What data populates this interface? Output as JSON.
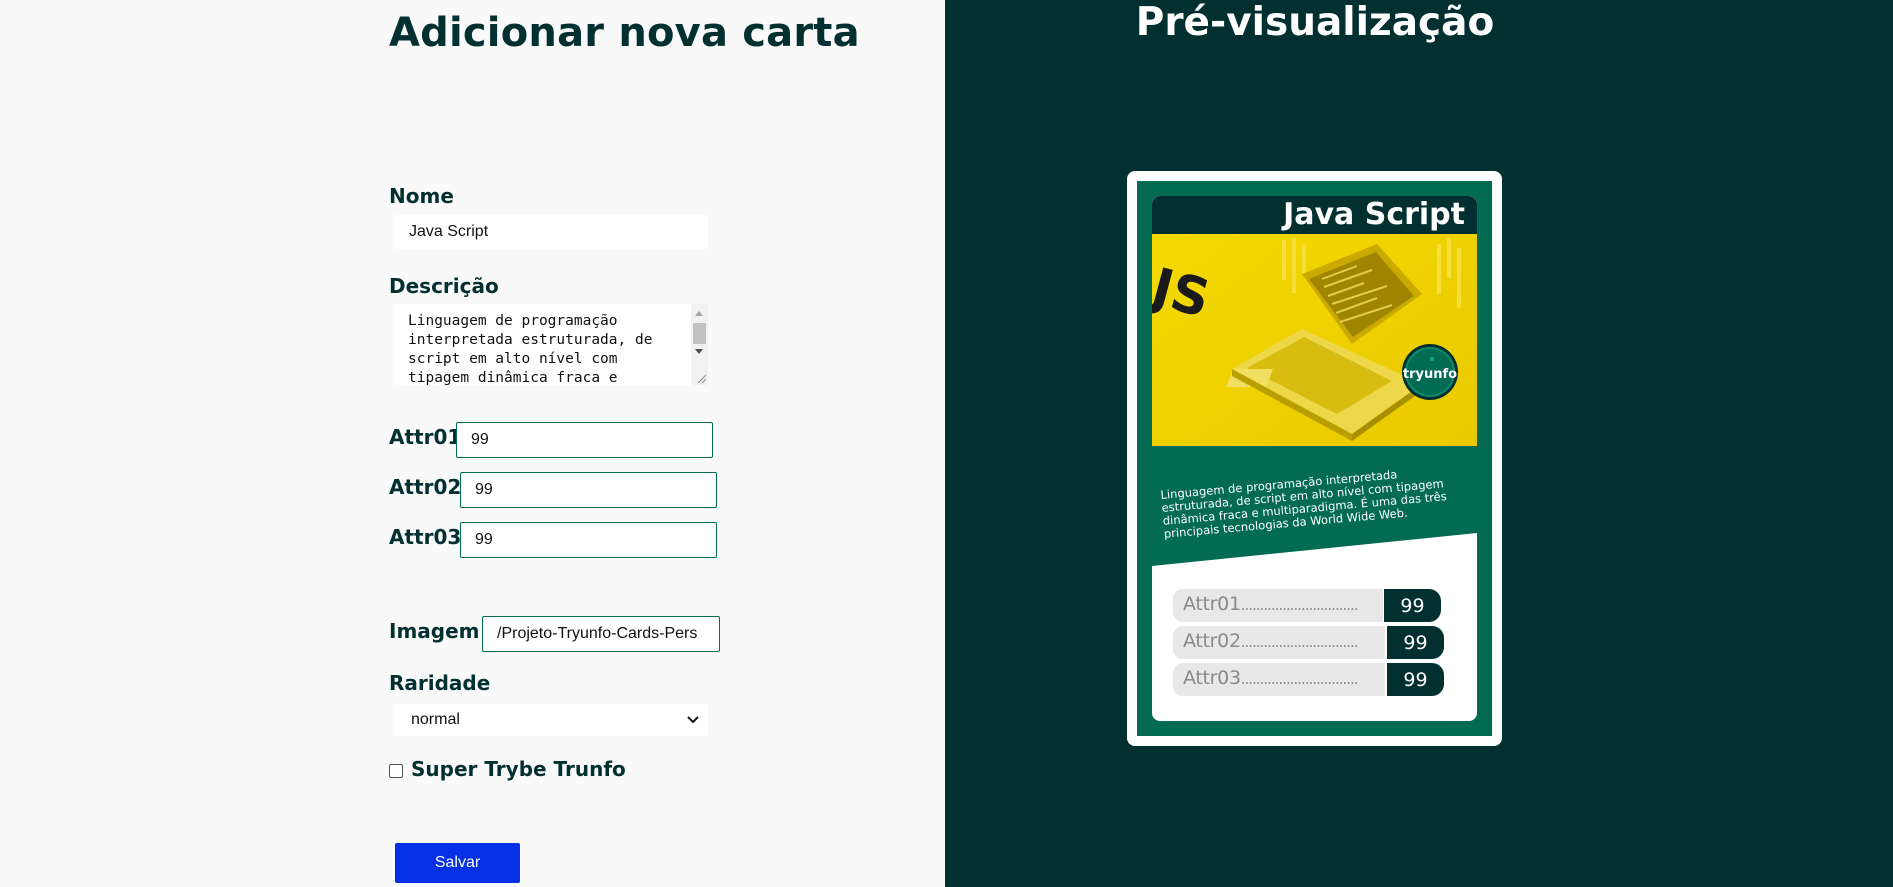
{
  "form": {
    "title": "Adicionar nova carta",
    "name_label": "Nome",
    "name_value": "Java Script",
    "description_label": "Descrição",
    "description_value": "Linguagem de programação interpretada estruturada, de script em alto nível com tipagem dinâmica fraca e",
    "attr1_label": "Attr01",
    "attr1_value": "99",
    "attr2_label": "Attr02",
    "attr2_value": "99",
    "attr3_label": "Attr03",
    "attr3_value": "99",
    "image_label": "Imagem",
    "image_value": "/Projeto-Tryunfo-Cards-Pers",
    "rarity_label": "Raridade",
    "rarity_value": "normal",
    "super_trunfo_label": "Super Trybe Trunfo",
    "super_trunfo_checked": false,
    "save_label": "Salvar"
  },
  "preview": {
    "title": "Pré-visualização",
    "card": {
      "name": "Java Script",
      "image_logo_text": "JS",
      "badge_text": "tryunfo",
      "description": "Linguagem de programação interpretada estruturada, de script em alto nível com tipagem dinâmica fraca e multiparadigma. É uma das três principais tecnologias da World Wide Web.",
      "attributes": [
        {
          "label": "Attr01",
          "dots": "...............................",
          "value": "99"
        },
        {
          "label": "Attr02",
          "dots": "...............................",
          "value": "99"
        },
        {
          "label": "Attr03",
          "dots": "...............................",
          "value": "99"
        }
      ]
    }
  },
  "colors": {
    "dark_green": "#023031",
    "card_green": "#036b52",
    "button_blue": "#0530e5",
    "image_yellow": "#f2d500"
  }
}
